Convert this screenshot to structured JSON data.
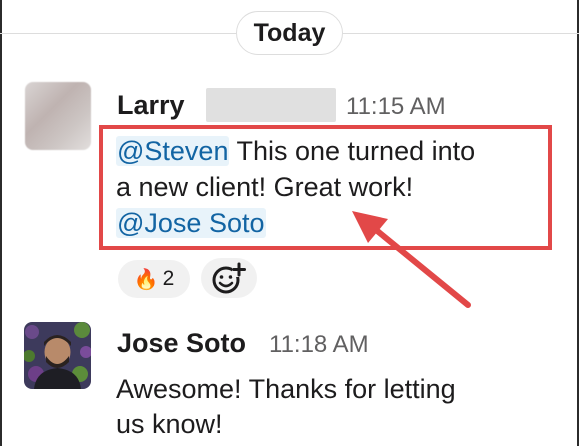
{
  "day_divider": {
    "label": "Today"
  },
  "messages": [
    {
      "author": "Larry",
      "time": "11:15 AM",
      "line1_mention": "@Steven",
      "line1_text": " This one turned into",
      "line2_text": "a new client! Great work!",
      "line3_mention": "@Jose Soto",
      "reaction": {
        "emoji": "fire-icon",
        "emoji_char": "🔥",
        "count": "2"
      }
    },
    {
      "author": "Jose Soto",
      "time": "11:18 AM",
      "line1_text": "Awesome! Thanks for letting",
      "line2_text": "us know!"
    }
  ],
  "colors": {
    "mention": "#1264a3",
    "mention_bg": "#e8f3fa",
    "annotation": "#e24848",
    "timestamp": "#616061"
  }
}
